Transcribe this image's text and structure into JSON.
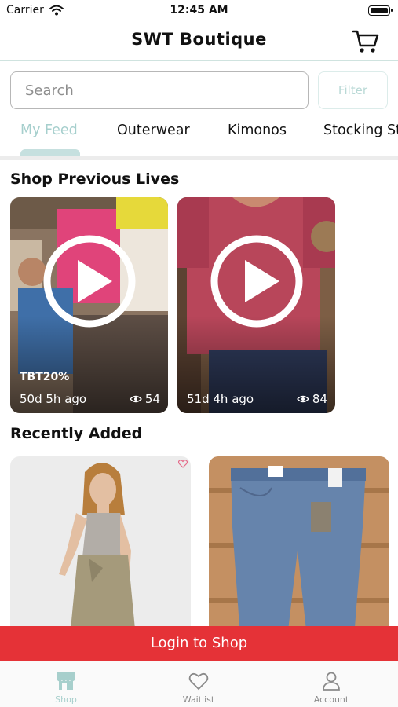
{
  "status_bar": {
    "carrier": "Carrier",
    "time": "12:45 AM"
  },
  "header": {
    "title": "SWT Boutique"
  },
  "search": {
    "placeholder": "Search",
    "value": "",
    "filter_label": "Filter"
  },
  "category_tabs": [
    {
      "label": "My Feed",
      "active": true
    },
    {
      "label": "Outerwear",
      "active": false
    },
    {
      "label": "Kimonos",
      "active": false
    },
    {
      "label": "Stocking Stuffers",
      "active": false
    }
  ],
  "sections": {
    "previous_lives": {
      "title": "Shop Previous Lives",
      "items": [
        {
          "promo": "TBT20%",
          "time_ago": "50d 5h ago",
          "views": "54"
        },
        {
          "promo": "",
          "time_ago": "51d 4h ago",
          "views": "84"
        }
      ]
    },
    "recently_added": {
      "title": "Recently Added"
    }
  },
  "login_banner": {
    "label": "Login to Shop"
  },
  "bottom_tabs": [
    {
      "label": "Shop",
      "icon": "shop-icon",
      "active": true
    },
    {
      "label": "Waitlist",
      "icon": "heart-icon",
      "active": false
    },
    {
      "label": "Account",
      "icon": "person-icon",
      "active": false
    }
  ],
  "colors": {
    "accent": "#a6cfcd",
    "login_red": "#e53237"
  }
}
